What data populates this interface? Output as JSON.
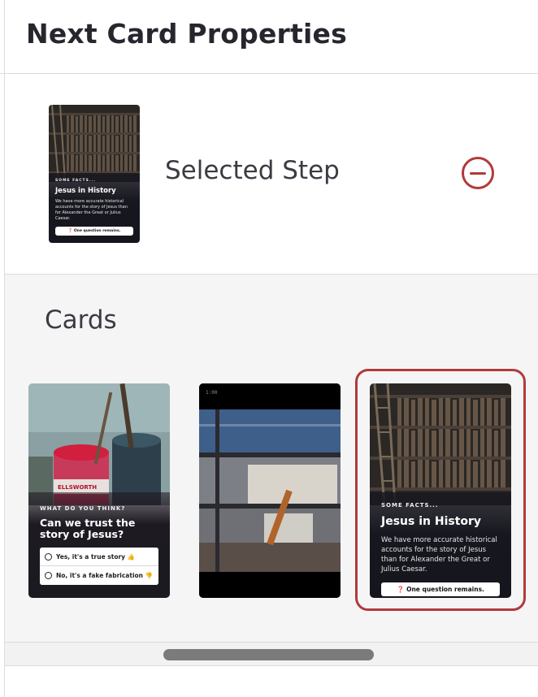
{
  "header": {
    "title": "Next Card Properties"
  },
  "selected_step": {
    "label": "Selected Step",
    "remove_icon": "minus-circle-icon",
    "thumb": {
      "kicker": "SOME FACTS...",
      "title": "Jesus in History",
      "body": "We have more accurate historical accounts for the story of Jesus than for Alexander the Great or Julius Caesar.",
      "button_icon": "question-circle-icon",
      "button_label": "One question remains."
    }
  },
  "cards": {
    "title": "Cards",
    "items": [
      {
        "kind": "poll",
        "kicker": "WHAT DO YOU THINK?",
        "title": "Can we trust the story of Jesus?",
        "can_label": "ELLSWORTH",
        "options": [
          {
            "label": "Yes, it's a true story 👍"
          },
          {
            "label": "No, it's a fake fabrication 👎"
          }
        ]
      },
      {
        "kind": "video",
        "time": "1:00"
      },
      {
        "kind": "fact",
        "kicker": "SOME FACTS...",
        "title": "Jesus in History",
        "body": "We have more accurate historical accounts for the story of Jesus than for Alexander the Great or Julius Caesar.",
        "button_icon": "question-circle-icon",
        "button_label": "One question remains.",
        "selected": true
      }
    ]
  },
  "colors": {
    "accent": "#b23a3a",
    "card_dark": "#17171f",
    "text": "#3b3b44",
    "scrollbar": "#7b7b7b"
  }
}
